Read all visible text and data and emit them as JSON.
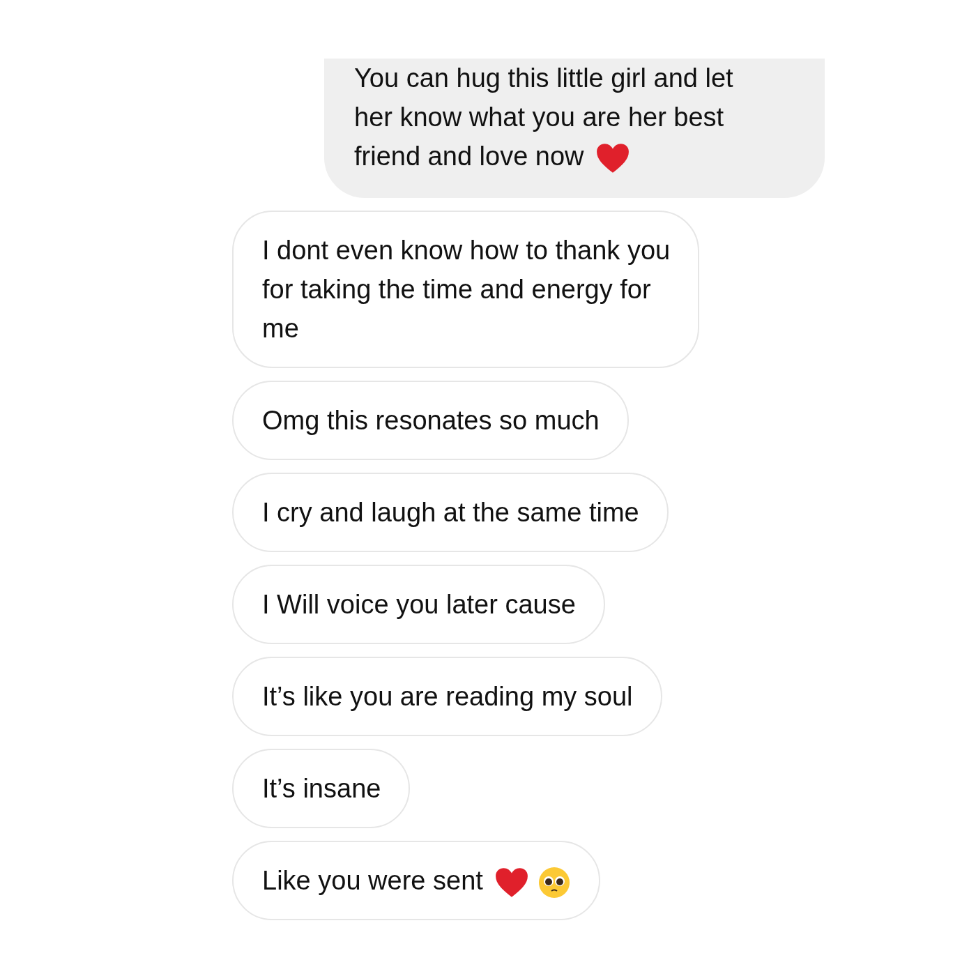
{
  "messages": [
    {
      "kind": "sent",
      "lines": [
        "You can hug this little girl and let",
        "her know what you are her best",
        "friend and love now"
      ],
      "emojis": [
        {
          "kind": "heart"
        }
      ]
    },
    {
      "kind": "received",
      "lines": [
        "I dont even know how to thank you",
        "for taking the time and energy for",
        "me"
      ]
    },
    {
      "kind": "received",
      "lines": [
        "Omg this resonates so much"
      ]
    },
    {
      "kind": "received",
      "lines": [
        "I cry and laugh at the same time"
      ]
    },
    {
      "kind": "received",
      "lines": [
        "I Will voice you later cause"
      ]
    },
    {
      "kind": "received",
      "lines": [
        "It’s like you are reading my soul"
      ]
    },
    {
      "kind": "received",
      "lines": [
        "It’s insane"
      ]
    },
    {
      "kind": "received",
      "lines": [
        "Like you were sent"
      ],
      "emojis": [
        {
          "kind": "heart"
        },
        {
          "kind": "pleading"
        }
      ]
    }
  ]
}
